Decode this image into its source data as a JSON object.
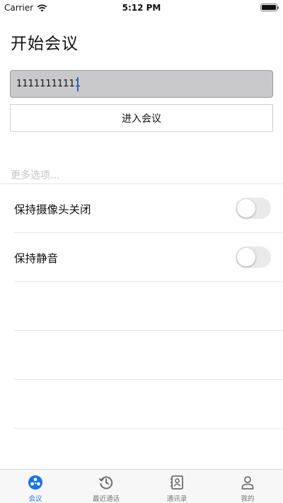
{
  "status_bar": {
    "carrier": "Carrier",
    "time": "5:12 PM"
  },
  "page": {
    "title": "开始会议"
  },
  "meeting_input": {
    "value": "11111111111",
    "placeholder": ""
  },
  "join_button": {
    "label": "进入会议"
  },
  "more_options": {
    "label": "更多选项..."
  },
  "settings": [
    {
      "label": "保持摄像头关闭",
      "enabled": false
    },
    {
      "label": "保持静音",
      "enabled": false
    }
  ],
  "tabbar": {
    "active_color": "#1a73e8",
    "inactive_color": "#777777",
    "items": [
      {
        "label": "会议",
        "icon": "meeting-icon",
        "active": true
      },
      {
        "label": "最近通话",
        "icon": "history-icon",
        "active": false
      },
      {
        "label": "通讯录",
        "icon": "contacts-icon",
        "active": false
      },
      {
        "label": "我的",
        "icon": "person-icon",
        "active": false
      }
    ]
  }
}
